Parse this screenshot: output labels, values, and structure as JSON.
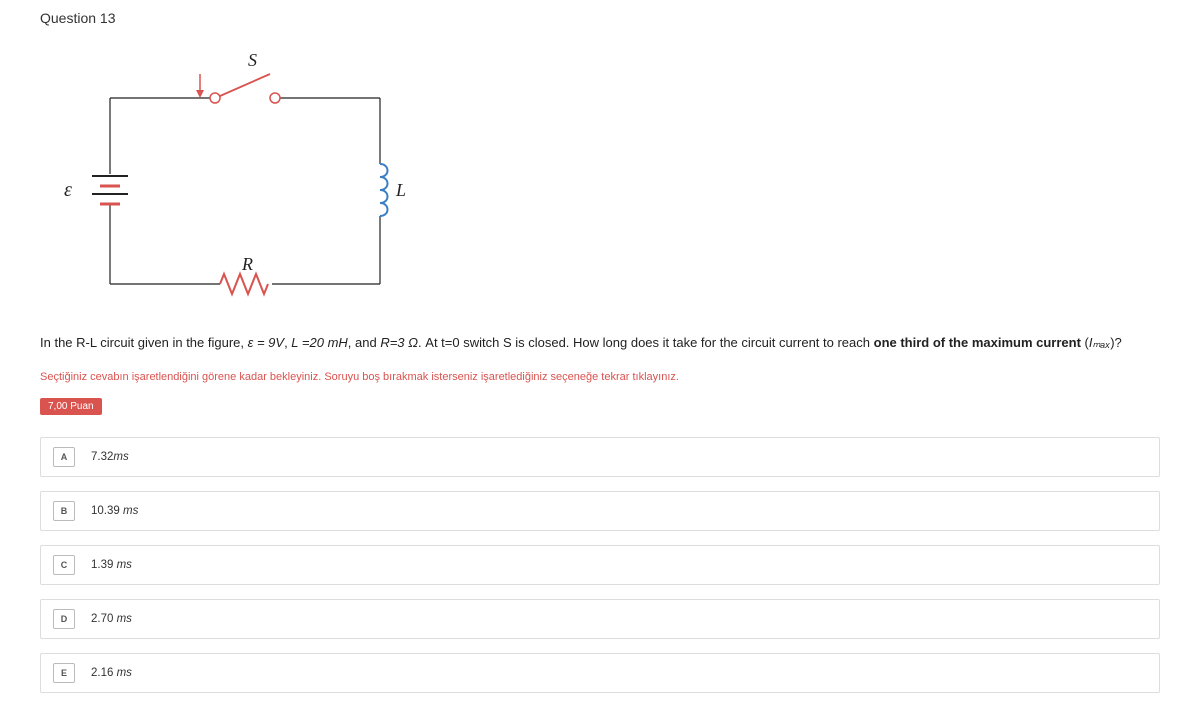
{
  "header": {
    "question_label": "Question 13"
  },
  "circuit": {
    "emf_label": "ε",
    "switch_label": "S",
    "inductor_label": "L",
    "resistor_label": "R"
  },
  "question": {
    "text_prefix": "In the R-L circuit given in the figure, ",
    "eq1": "ε = 9V",
    "sep1": ", ",
    "eq2": "L =20 mH",
    "sep2": ", and ",
    "eq3": "R=3 Ω",
    "text_mid": ". At t=0 switch S is closed. How long does it take for the circuit current to reach ",
    "bold_part": "one third of the maximum current",
    "text_suffix": " (",
    "imax": "Iₘₐₓ",
    "text_end": ")?"
  },
  "instruction": "Seçtiğiniz cevabın işaretlendiğini görene kadar bekleyiniz. Soruyu boş bırakmak isterseniz işaretlediğiniz seçeneğe tekrar tıklayınız.",
  "points_label": "7,00 Puan",
  "options": [
    {
      "letter": "A",
      "value": "7.32",
      "unit": "ms"
    },
    {
      "letter": "B",
      "value": "10.39 ",
      "unit": "ms"
    },
    {
      "letter": "C",
      "value": "1.39 ",
      "unit": "ms"
    },
    {
      "letter": "D",
      "value": "2.70 ",
      "unit": "ms"
    },
    {
      "letter": "E",
      "value": "2.16 ",
      "unit": "ms"
    }
  ]
}
